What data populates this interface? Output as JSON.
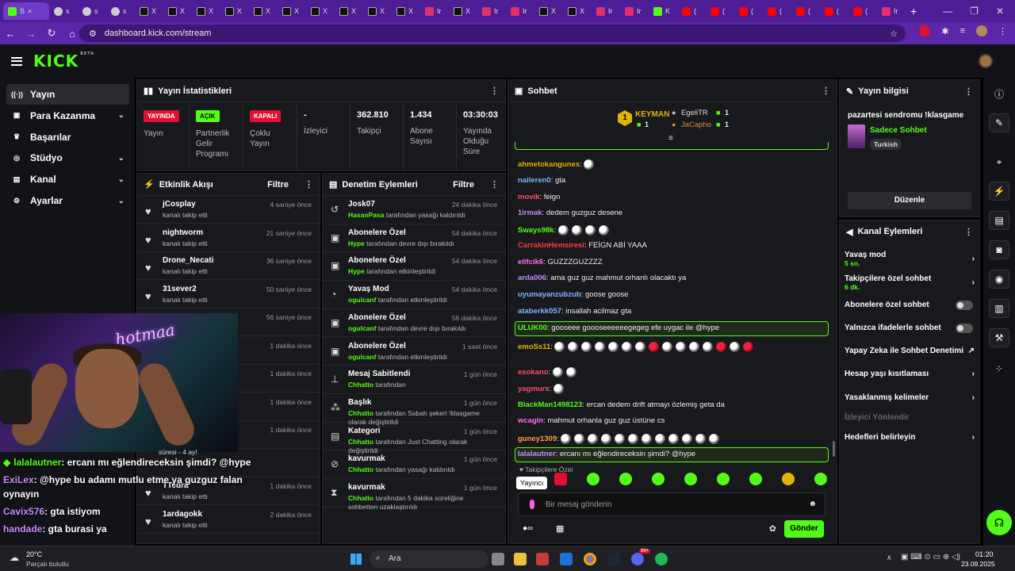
{
  "browser": {
    "active_tab": "S",
    "url": "dashboard.kick.com/stream",
    "tabs": [
      {
        "type": "g",
        "label": "s"
      },
      {
        "type": "g",
        "label": "s"
      },
      {
        "type": "g",
        "label": "s"
      },
      {
        "type": "x",
        "label": "X"
      },
      {
        "type": "x",
        "label": "X"
      },
      {
        "type": "x",
        "label": "X"
      },
      {
        "type": "x",
        "label": "X"
      },
      {
        "type": "x",
        "label": "X"
      },
      {
        "type": "x",
        "label": "X"
      },
      {
        "type": "x",
        "label": "X"
      },
      {
        "type": "x",
        "label": "X"
      },
      {
        "type": "x",
        "label": "X"
      },
      {
        "type": "x",
        "label": "X"
      },
      {
        "type": "i",
        "label": "Ir"
      },
      {
        "type": "x",
        "label": "X"
      },
      {
        "type": "i",
        "label": "Ir"
      },
      {
        "type": "i",
        "label": "Ir"
      },
      {
        "type": "x",
        "label": "X"
      },
      {
        "type": "x",
        "label": "X"
      },
      {
        "type": "i",
        "label": "Ir"
      },
      {
        "type": "i",
        "label": "Ir"
      },
      {
        "type": "k",
        "label": "K"
      },
      {
        "type": "y",
        "label": "("
      },
      {
        "type": "y",
        "label": "("
      },
      {
        "type": "y",
        "label": "("
      },
      {
        "type": "y",
        "label": "("
      },
      {
        "type": "y",
        "label": "("
      },
      {
        "type": "y",
        "label": "("
      },
      {
        "type": "y",
        "label": "("
      },
      {
        "type": "i",
        "label": "Ir"
      }
    ],
    "new_tab": "+"
  },
  "app": {
    "logo": "KICK",
    "beta": "BETA"
  },
  "sidebar": {
    "items": [
      {
        "label": "Yayın",
        "icon": "broadcast-icon",
        "chevron": false
      },
      {
        "label": "Para Kazanma",
        "icon": "money-icon",
        "chevron": true
      },
      {
        "label": "Başarılar",
        "icon": "trophy-icon",
        "chevron": false
      },
      {
        "label": "Stüdyo",
        "icon": "studio-icon",
        "chevron": true
      },
      {
        "label": "Kanal",
        "icon": "channel-icon",
        "chevron": true
      },
      {
        "label": "Ayarlar",
        "icon": "settings-icon",
        "chevron": true
      }
    ]
  },
  "stats": {
    "title": "Yayın İstatistikleri",
    "items": [
      {
        "badge": "YAYINDA",
        "badge_color": "#e0102f",
        "label": "Yayın"
      },
      {
        "badge": "AÇIK",
        "badge_color": "#53fc18",
        "label": "Partnerlik Gelir Programı"
      },
      {
        "badge": "KAPALI",
        "badge_color": "#e0102f",
        "label": "Çoklu Yayın"
      },
      {
        "value": "-",
        "label": "İzleyici"
      },
      {
        "value": "362.810",
        "label": "Takipçi"
      },
      {
        "value": "1.434",
        "label": "Abone Sayısı"
      },
      {
        "value": "03:30:03",
        "label": "Yayında Olduğu Süre"
      }
    ]
  },
  "activity": {
    "title": "Etkinlik Akışı",
    "filter": "Filtre",
    "rows": [
      {
        "name": "jCosplay",
        "sub": "kanalı takip etti",
        "time": "4 saniye önce"
      },
      {
        "name": "nightworm",
        "sub": "kanalı takip etti",
        "time": "21 saniye önce"
      },
      {
        "name": "Drone_Necati",
        "sub": "kanalı takip etti",
        "time": "36 saniye önce"
      },
      {
        "name": "31sever2",
        "sub": "kanalı takip etti",
        "time": "50 saniye önce"
      },
      {
        "name": "",
        "sub": "",
        "time": "56 saniye önce"
      },
      {
        "name": "xx",
        "sub": "",
        "time": "1 dakika önce"
      },
      {
        "name": "",
        "sub": "",
        "time": "1 dakika önce"
      },
      {
        "name": "",
        "sub": "",
        "time": "1 dakika önce"
      },
      {
        "name": "",
        "sub": "uyor! Toplam abonelik",
        "time": "1 dakika önce"
      },
      {
        "name": "",
        "sub": "",
        "time": ""
      },
      {
        "name": "TTedra",
        "sub": "kanalı takip etti",
        "time": "1 dakika önce"
      },
      {
        "name": "1ardagokk",
        "sub": "kanalı takip etti",
        "time": "2 dakika önce"
      }
    ],
    "sub_duration": "süresi - 4 ay!"
  },
  "moderation": {
    "title": "Denetim Eylemleri",
    "filter": "Filtre",
    "rows": [
      {
        "icon": "↺",
        "name": "Josk07",
        "actor": "HasanPasa",
        "sub": "tarafından yasağı kaldırıldı",
        "time": "24 dakika önce"
      },
      {
        "icon": "▣",
        "name": "Abonelere Özel",
        "actor": "Hype",
        "sub": "tarafından devre dışı bırakıldı",
        "time": "54 dakika önce"
      },
      {
        "icon": "▣",
        "name": "Abonelere Özel",
        "actor": "Hype",
        "sub": "tarafından etkinleştirildi",
        "time": "54 dakika önce"
      },
      {
        "icon": "◔",
        "name": "Yavaş Mod",
        "actor": "ogulcanf",
        "sub": "tarafından etkinleştirildi",
        "time": "54 dakika önce"
      },
      {
        "icon": "▣",
        "name": "Abonelere Özel",
        "actor": "ogulcanf",
        "sub": "tarafından devre dışı bırakıldı",
        "time": "56 dakika önce"
      },
      {
        "icon": "▣",
        "name": "Abonelere Özel",
        "actor": "ogulcanf",
        "sub": "tarafından etkinleştirildi",
        "time": "1 saat önce"
      },
      {
        "icon": "⊥",
        "name": "Mesaj Sabitlendi",
        "actor": "Chhatto",
        "sub": "tarafından",
        "time": "1 gün önce"
      },
      {
        "icon": "⁂",
        "name": "Başlık",
        "actor": "Chhatto",
        "sub": "tarafından Sabah şekeri !klasgame olarak değiştirildi",
        "time": "1 gün önce"
      },
      {
        "icon": "▤",
        "name": "Kategori",
        "actor": "Chhatto",
        "sub": "tarafından Just Chatting olarak değiştirildi",
        "time": "1 gün önce"
      },
      {
        "icon": "⊘",
        "name": "kavurmak",
        "actor": "Chhatto",
        "sub": "tarafından yasağı kaldırıldı",
        "time": "1 gün önce"
      },
      {
        "icon": "⧗",
        "name": "kavurmak",
        "actor": "Chhatto",
        "sub": "tarafından 5 dakika süreliğine sohbetten uzaklaştırıldı",
        "time": "1 gün önce"
      }
    ]
  },
  "chat": {
    "title": "Sohbet",
    "leaders": [
      {
        "rank": "1",
        "name": "KEYMAN",
        "count": "1"
      },
      {
        "name": "EgeliTR",
        "count": "1"
      },
      {
        "name": "JaCapho",
        "count": "1"
      }
    ],
    "messages": [
      {
        "user": "ahmetokangunes",
        "color": "#e0b400",
        "text": "",
        "emotes": 1,
        "reds": 0
      },
      {
        "user": "naileren0",
        "color": "#7fb7ff",
        "text": "gta",
        "emotes": 0,
        "reds": 0
      },
      {
        "user": "movik",
        "color": "#ff4e6a",
        "text": "feign",
        "emotes": 0,
        "reds": 0
      },
      {
        "user": "1irmak",
        "color": "#c78bff",
        "text": "dedem guzguz desene",
        "emotes": 0,
        "reds": 0
      },
      {
        "user": "Sways98k",
        "color": "#53fc18",
        "text": "",
        "emotes": 4,
        "reds": 0
      },
      {
        "user": "CarrakinHemsiresi",
        "color": "#ff3b3b",
        "text": "FEİGN ABİ YAAA",
        "emotes": 0,
        "reds": 0
      },
      {
        "user": "elifcik6",
        "color": "#ff6ef0",
        "text": "GUZZZGUZZZZ",
        "emotes": 0,
        "reds": 0
      },
      {
        "user": "arda006",
        "color": "#c78bff",
        "text": "ama guz guz mahmut orhanlı olacaktı ya",
        "emotes": 0,
        "reds": 0
      },
      {
        "user": "uyumayanzubzub",
        "color": "#7fb7ff",
        "text": "goose goose",
        "emotes": 0,
        "reds": 0
      },
      {
        "user": "ataberkk057",
        "color": "#7fb7ff",
        "text": "insallah acilmaz gta",
        "emotes": 0,
        "reds": 0
      },
      {
        "user": "ULUK00",
        "color": "#53fc18",
        "text": "gooseee goooseeeeeegegeg efe uygac ile @hype",
        "emotes": 0,
        "reds": 0,
        "highlight": true
      },
      {
        "user": "emoSs11",
        "color": "#e0b400",
        "text": "",
        "emotes": 15,
        "reds": 3
      },
      {
        "user": "esokano",
        "color": "#ff4e6a",
        "text": "",
        "emotes": 2,
        "reds": 0
      },
      {
        "user": "yagmurs",
        "color": "#ff4e6a",
        "text": "",
        "emotes": 1,
        "reds": 0
      },
      {
        "user": "BlackMan1498123",
        "color": "#53fc18",
        "text": "ercan dedem drift atmayı özlemiş geta da",
        "emotes": 0,
        "reds": 0
      },
      {
        "user": "wcagin",
        "color": "#ff6ef0",
        "text": "mahmut orhanla guz guz üstüne cs",
        "emotes": 0,
        "reds": 0
      },
      {
        "user": "guney1309",
        "color": "#ff9f43",
        "text": "",
        "emotes": 12,
        "reds": 0
      },
      {
        "user": "lalalautner",
        "color": "#c78bff",
        "text": "ercanı mı eğlendireceksin şimdi? @hype",
        "emotes": 0,
        "reds": 0,
        "highlight": true
      }
    ],
    "followers_only": "Takipçilere Özel",
    "tooltip": "Yayıncı",
    "input_placeholder": "Bir mesaj gönderin",
    "send_label": "Gönder"
  },
  "stream_info": {
    "title": "Yayın bilgisi",
    "stream_title": "pazartesi sendromu !klasgame",
    "category": "Sadece Sohbet",
    "tag": "Turkish",
    "edit_label": "Düzenle"
  },
  "channel_actions": {
    "title": "Kanal Eylemleri",
    "items": [
      {
        "label": "Yavaş mod",
        "sub": "5 sn.",
        "control": "chevron"
      },
      {
        "label": "Takipçilere özel sohbet",
        "sub": "6 dk.",
        "control": "chevron"
      },
      {
        "label": "Abonelere özel sohbet",
        "sub": "",
        "control": "toggle"
      },
      {
        "label": "Yalnızca ifadelerle sohbet",
        "sub": "",
        "control": "toggle"
      },
      {
        "label": "Yapay Zeka ile Sohbet Denetimi",
        "sub": "",
        "control": "external"
      },
      {
        "label": "Hesap yaşı kısıtlaması",
        "sub": "",
        "control": "chevron"
      },
      {
        "label": "Yasaklanmış kelimeler",
        "sub": "",
        "control": "chevron"
      },
      {
        "label": "İzleyici Yönlendir",
        "sub": "",
        "control": "disabled"
      },
      {
        "label": "Hedefleri belirleyin",
        "sub": "",
        "control": "chevron"
      }
    ]
  },
  "overlay": {
    "neon_text": "hotmaa",
    "messages": [
      {
        "user": "lalalautner",
        "color": "#53fc18",
        "text": ": ercanı mı eğlendireceksin şimdi? @hype",
        "prefix": "◆"
      },
      {
        "user": "ExiLex",
        "color": "#c78bff",
        "text": ": @hype bu adamı mutlu etme ya guzguz falan",
        "prefix": ""
      },
      {
        "user": "",
        "color": "#ffffff",
        "text": "oynayın",
        "prefix": ""
      },
      {
        "user": "Cavix576",
        "color": "#c78bff",
        "text": ": gta istiyom",
        "prefix": ""
      },
      {
        "user": "handade",
        "color": "#c78bff",
        "text": ": gta burasi ya",
        "prefix": ""
      }
    ]
  },
  "taskbar": {
    "weather_temp": "20°C",
    "weather_desc": "Parçalı bulutlu",
    "search_label": "Ara",
    "time": "01:20",
    "date": "23.09.2025",
    "badge": "99+"
  }
}
